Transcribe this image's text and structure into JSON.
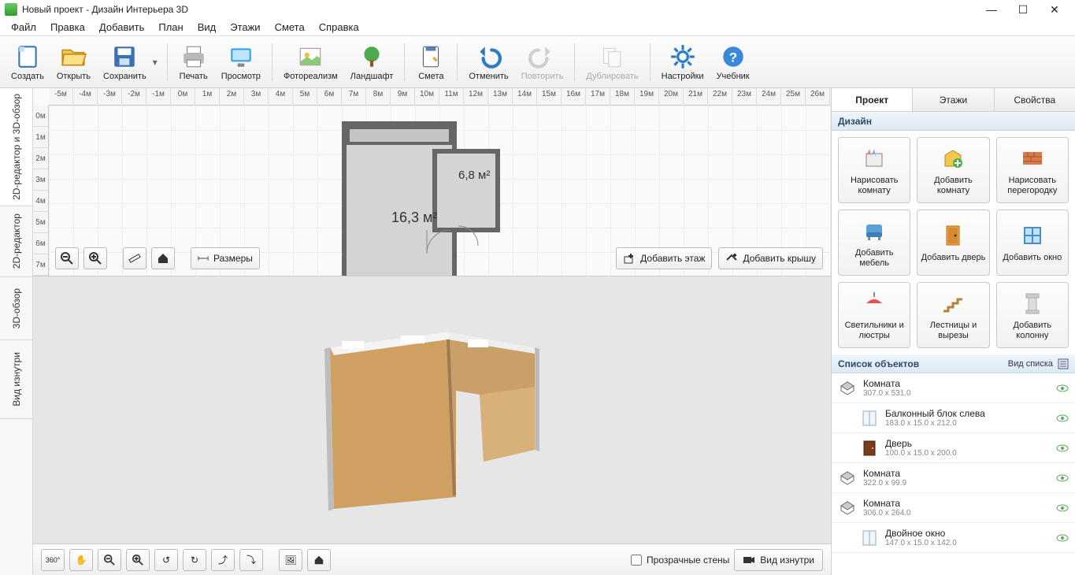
{
  "window": {
    "title": "Новый проект - Дизайн Интерьера 3D"
  },
  "menu": {
    "file": "Файл",
    "edit": "Правка",
    "add": "Добавить",
    "plan": "План",
    "view": "Вид",
    "floors": "Этажи",
    "estimate": "Смета",
    "help": "Справка"
  },
  "toolbar": {
    "create": "Создать",
    "open": "Открыть",
    "save": "Сохранить",
    "print": "Печать",
    "preview": "Просмотр",
    "photoreal": "Фотореализм",
    "landscape": "Ландшафт",
    "estimate": "Смета",
    "undo": "Отменить",
    "redo": "Повторить",
    "duplicate": "Дублировать",
    "settings": "Настройки",
    "tutorial": "Учебник"
  },
  "viewtabs": {
    "combo": "2D-редактор и 3D-обзор",
    "editor": "2D-редактор",
    "view3d": "3D-обзор",
    "inside": "Вид изнутри"
  },
  "ruler": {
    "h": [
      "-5м",
      "-4м",
      "-3м",
      "-2м",
      "-1м",
      "0м",
      "1м",
      "2м",
      "3м",
      "4м",
      "5м",
      "6м",
      "7м",
      "8м",
      "9м",
      "10м",
      "11м",
      "12м",
      "13м",
      "14м",
      "15м",
      "16м",
      "17м",
      "18м",
      "19м",
      "20м",
      "21м",
      "22м",
      "23м",
      "24м",
      "25м",
      "26м"
    ],
    "v": [
      "0м",
      "1м",
      "2м",
      "3м",
      "4м",
      "5м",
      "6м",
      "7м"
    ]
  },
  "plan": {
    "room_big": "16,3 м²",
    "room_small": "6,8 м²",
    "sizes_btn": "Размеры",
    "add_floor": "Добавить этаж",
    "add_roof": "Добавить крышу"
  },
  "bottom": {
    "transparent_walls": "Прозрачные стены",
    "inside_view": "Вид изнутри"
  },
  "rtabs": {
    "project": "Проект",
    "floors": "Этажи",
    "props": "Свойства"
  },
  "design": {
    "head": "Дизайн",
    "draw_room": "Нарисовать комнату",
    "add_room": "Добавить комнату",
    "draw_partition": "Нарисовать перегородку",
    "add_furniture": "Добавить мебель",
    "add_door": "Добавить дверь",
    "add_window": "Добавить окно",
    "add_lights": "Светильники и люстры",
    "add_stairs": "Лестницы и вырезы",
    "add_column": "Добавить колонну"
  },
  "objlist": {
    "head": "Список объектов",
    "view_mode": "Вид списка",
    "items": [
      {
        "name": "Комната",
        "dim": "307.0 x 531.0",
        "icon": "room",
        "indent": false
      },
      {
        "name": "Балконный блок слева",
        "dim": "183.0 x 15.0 x 212.0",
        "icon": "window-block",
        "indent": true
      },
      {
        "name": "Дверь",
        "dim": "100.0 x 15.0 x 200.0",
        "icon": "door",
        "indent": true
      },
      {
        "name": "Комната",
        "dim": "322.0 x 99.9",
        "icon": "room",
        "indent": false
      },
      {
        "name": "Комната",
        "dim": "306.0 x 264.0",
        "icon": "room",
        "indent": false
      },
      {
        "name": "Двойное окно",
        "dim": "147.0 x 15.0 x 142.0",
        "icon": "window",
        "indent": true
      }
    ]
  }
}
